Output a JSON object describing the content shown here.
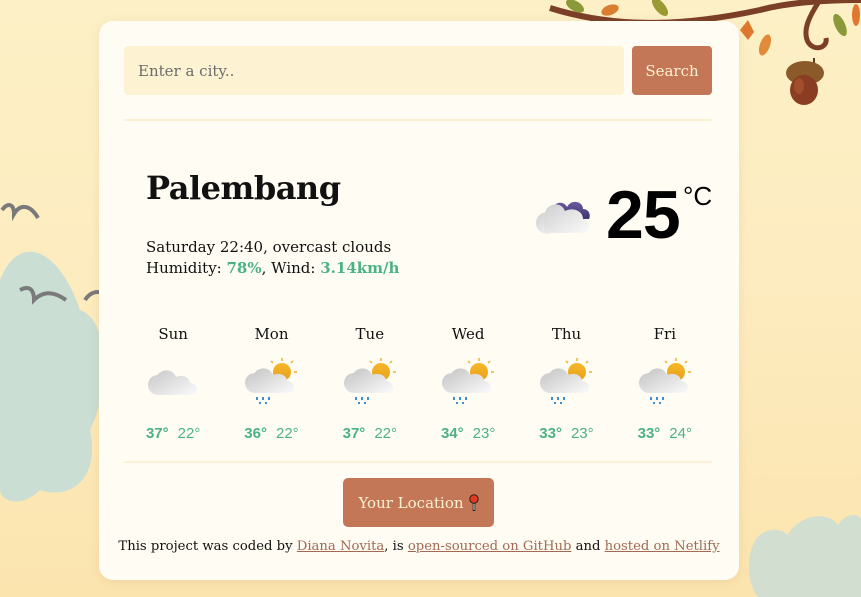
{
  "search": {
    "placeholder": "Enter a city..",
    "value": "",
    "button_label": "Search"
  },
  "current": {
    "city": "Palembang",
    "datetime": "Saturday 22:40",
    "description": "overcast clouds",
    "humidity_label": "Humidity: ",
    "humidity": "78%",
    "wind_label": ", Wind: ",
    "wind": "3.14km/h",
    "temperature": "25",
    "unit": "°C",
    "icon": "overcast-clouds-icon"
  },
  "forecast": [
    {
      "day": "Sun",
      "max": "37°",
      "min": "22°",
      "icon": "cloudy-icon"
    },
    {
      "day": "Mon",
      "max": "36°",
      "min": "22°",
      "icon": "sun-cloud-rain-icon"
    },
    {
      "day": "Tue",
      "max": "37°",
      "min": "22°",
      "icon": "sun-cloud-rain-icon"
    },
    {
      "day": "Wed",
      "max": "34°",
      "min": "23°",
      "icon": "sun-cloud-rain-icon"
    },
    {
      "day": "Thu",
      "max": "33°",
      "min": "23°",
      "icon": "sun-cloud-rain-icon"
    },
    {
      "day": "Fri",
      "max": "33°",
      "min": "24°",
      "icon": "sun-cloud-rain-icon"
    }
  ],
  "location_button": {
    "label": "Your Location",
    "icon": "pushpin-icon"
  },
  "footer": {
    "prefix": "This project was coded by ",
    "author_link": "Diana Novita",
    "middle": ", is ",
    "github_link": "open-sourced on GitHub",
    "and": " and ",
    "netlify_link": "hosted on Netlify"
  },
  "colors": {
    "accent": "#c47756",
    "accent_text": "#fdf1d2",
    "highlight_green": "#4bb286",
    "input_bg": "#fdf3d3",
    "card_bg": "#fffcf4"
  }
}
